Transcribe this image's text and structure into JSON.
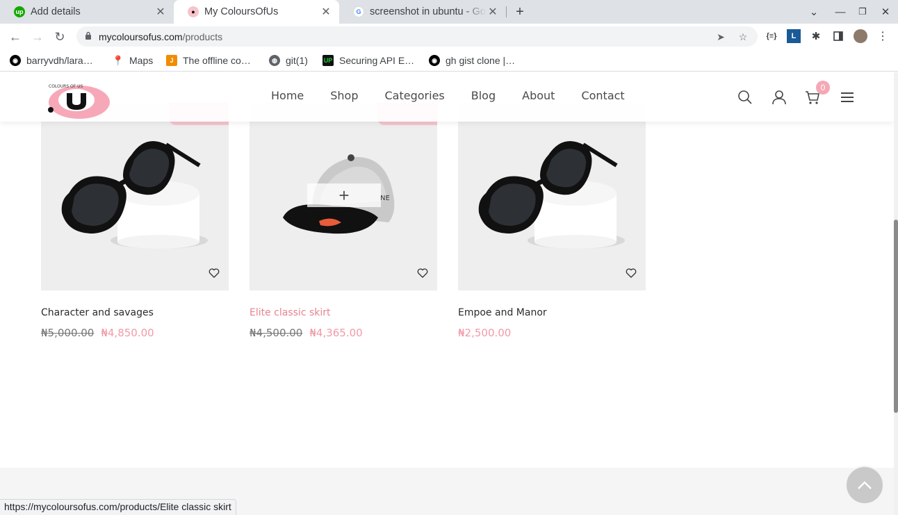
{
  "browser": {
    "tabs": [
      {
        "title": "Add details",
        "favicon": "upwork-icon"
      },
      {
        "title": "My ColoursOfUs",
        "favicon": "site-logo-icon",
        "active": true
      },
      {
        "title": "screenshot in ubuntu - Go",
        "favicon": "google-icon"
      }
    ],
    "url_host": "mycoloursofus.com",
    "url_path": "/products",
    "bookmarks": [
      {
        "label": "barryvdh/lara…",
        "icon": "github-icon"
      },
      {
        "label": "Maps",
        "icon": "maps-pin-icon"
      },
      {
        "label": "The offline co…",
        "icon": "j-icon"
      },
      {
        "label": "git(1)",
        "icon": "globe-icon"
      },
      {
        "label": "Securing API E…",
        "icon": "up-icon"
      },
      {
        "label": "gh gist clone |…",
        "icon": "github-icon"
      }
    ],
    "status_url": "https://mycoloursofus.com/products/Elite classic skirt"
  },
  "site": {
    "nav": [
      "Home",
      "Shop",
      "Categories",
      "Blog",
      "About",
      "Contact"
    ],
    "cart_count": "0",
    "accent": "#f19aa8",
    "logo_text": "COLOURS OF US"
  },
  "products": [
    {
      "name": "Character and savages",
      "old_price": "₦5,000.00",
      "price": "₦4,850.00",
      "image": "sunglasses",
      "badge": true
    },
    {
      "name": "Elite classic skirt",
      "old_price": "₦4,500.00",
      "price": "₦4,365.00",
      "image": "cap",
      "badge": true,
      "hover": true
    },
    {
      "name": "Empoe and Manor",
      "old_price": "",
      "price": "₦2,500.00",
      "image": "sunglasses",
      "badge": false
    }
  ]
}
